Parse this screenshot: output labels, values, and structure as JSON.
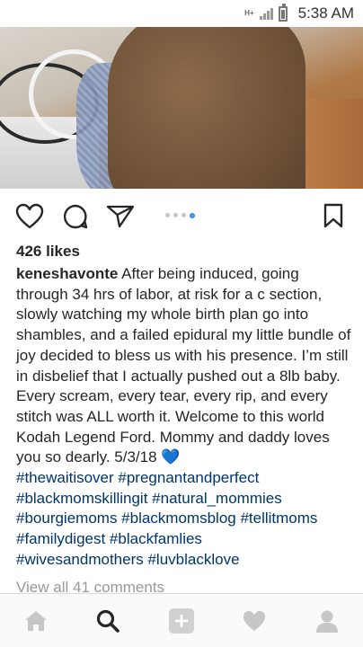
{
  "status_bar": {
    "network": "H+",
    "time": "5:38 AM"
  },
  "post": {
    "likes": "426 likes",
    "username": "keneshavonte",
    "caption": " After being induced, going through 34 hrs of labor, at risk for a c section, slowly watching my whole birth plan go into shambles, and a failed epidural my little bundle of joy decided to bless us with his presence. I’m still in disbelief that I actually pushed out a 8lb baby. Every scream, every tear, every rip, and every stitch was ALL worth it. Welcome to this world Kodah Legend Ford. Mommy and daddy loves you so dearly. 5/3/18 ",
    "caption_emoji": "💙",
    "hashtags": [
      "#thewaitisover #pregnantandperfect",
      "#blackmomskillingit #natural_mommies",
      "#bourgiemoms #blackmomsblog #tellitmoms",
      "#familydigest #blackfamlies",
      "#wivesandmothers #luvblacklove"
    ],
    "view_comments": "View all 41 comments",
    "carousel": {
      "count": 4,
      "active_index": 3
    }
  },
  "icons": {
    "like": "heart-outline-icon",
    "comment": "comment-bubble-icon",
    "share": "paper-plane-icon",
    "save": "bookmark-icon",
    "tabs": [
      "home-icon",
      "search-icon",
      "add-post-icon",
      "activity-heart-icon",
      "profile-icon"
    ]
  },
  "colors": {
    "accent": "#3897f0",
    "hashtag": "#003569",
    "muted": "#999999",
    "text": "#262626"
  }
}
